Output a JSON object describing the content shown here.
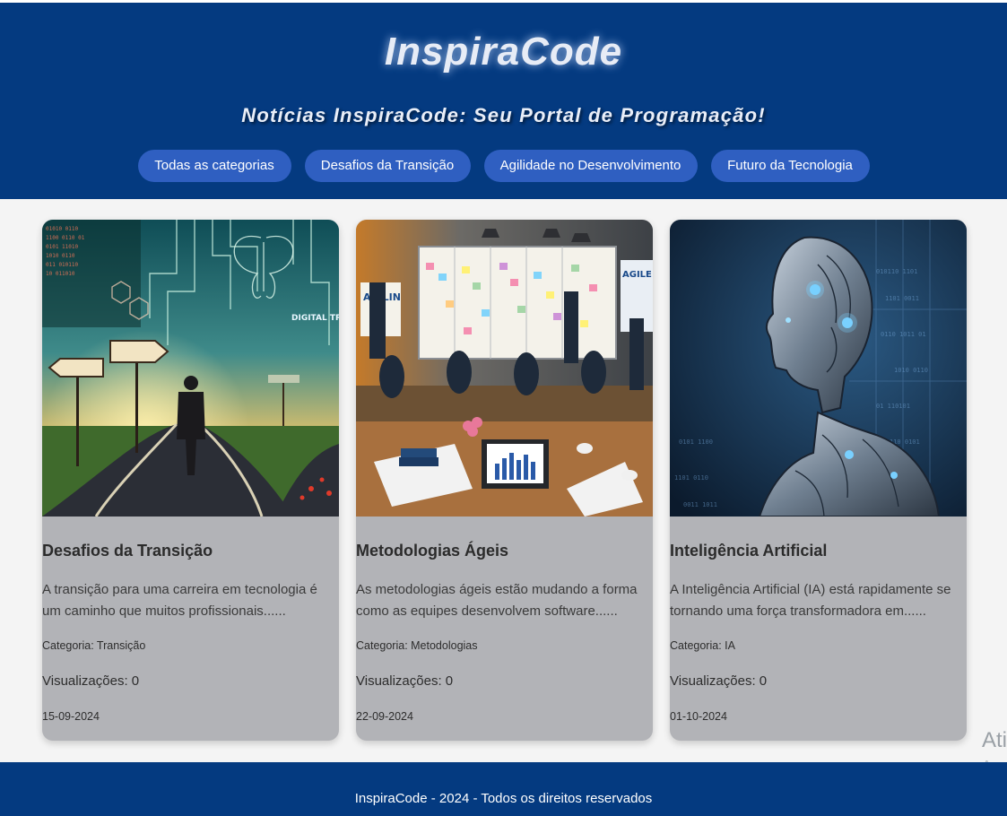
{
  "site": {
    "title": "InspiraCode",
    "tagline": "Notícias InspiraCode: Seu Portal de Programação!"
  },
  "nav": {
    "items": [
      "Todas as categorias",
      "Desafios da Transição",
      "Agilidade no Desenvolvimento",
      "Futuro da Tecnologia"
    ]
  },
  "cards": [
    {
      "title": "Desafios da Transição",
      "description": "A transição para uma carreira em tecnologia é um caminho que muitos profissionais......",
      "category": "Categoria: Transição",
      "views": "Visualizações: 0",
      "date": "15-09-2024",
      "image_caption": "DIGITAL TRANSFITI",
      "image_icon": "crossroads-illustration"
    },
    {
      "title": "Metodologias Ágeis",
      "description": "As metodologias ágeis estão mudando a forma como as equipes desenvolvem software......",
      "category": "Categoria: Metodologias",
      "views": "Visualizações: 0",
      "date": "22-09-2024",
      "image_caption": "AGILIN",
      "image_caption_2": "AGILE",
      "image_icon": "agile-meeting-illustration"
    },
    {
      "title": "Inteligência Artificial",
      "description": "A Inteligência Artificial (IA) está rapidamente se tornando uma força transformadora em......",
      "category": "Categoria: IA",
      "views": "Visualizações: 0",
      "date": "01-10-2024",
      "image_icon": "robot-illustration"
    }
  ],
  "footer": {
    "text": "InspiraCode - 2024 - Todos os direitos reservados"
  },
  "windows_watermark": {
    "line1": "Ati",
    "line2": "Ace"
  },
  "colors": {
    "header_bg": "#043a80",
    "nav_button": "#2f5fc1",
    "card_bg": "#b2b3b7",
    "page_bg": "#f4f4f4"
  }
}
